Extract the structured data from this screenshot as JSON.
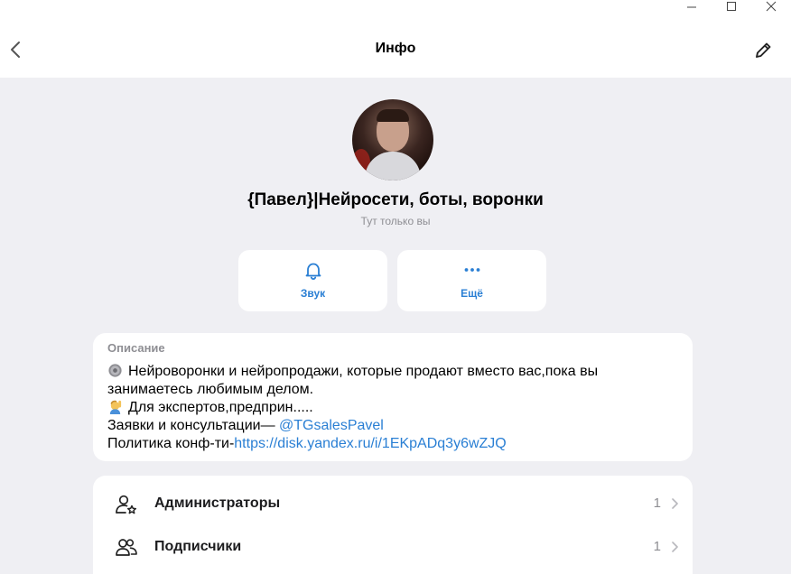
{
  "header": {
    "title": "Инфо"
  },
  "channel": {
    "name": "{Павел}|Нейросети, боты, воронки",
    "subtitle": "Тут только вы"
  },
  "actions": {
    "sound_label": "Звук",
    "more_label": "Ещё"
  },
  "description": {
    "title": "Описание",
    "line1": "Нейроворонки и нейропродажи, которые продают вместо вас,пока вы",
    "line2": "занимаетесь любимым делом.",
    "line3": "Для экспертов,предприн.....",
    "line4_prefix": "Заявки и консультации— ",
    "line4_link": "@TGsalesPavel",
    "line5_prefix": "Политика конф-ти-",
    "line5_link": "https://disk.yandex.ru/i/1EKpADq3y6wZJQ"
  },
  "list": {
    "admins_label": "Администраторы",
    "admins_count": "1",
    "subscribers_label": "Подписчики",
    "subscribers_count": "1"
  },
  "colors": {
    "accent": "#2a7fd4",
    "background": "#efeff3",
    "card": "#ffffff",
    "secondary_text": "#8e8e93"
  },
  "icons": {
    "back": "chevron-left-icon",
    "edit": "pencil-icon",
    "sound": "bell-icon",
    "more": "ellipsis-icon",
    "admins": "admin-star-icon",
    "subscribers": "users-icon"
  }
}
